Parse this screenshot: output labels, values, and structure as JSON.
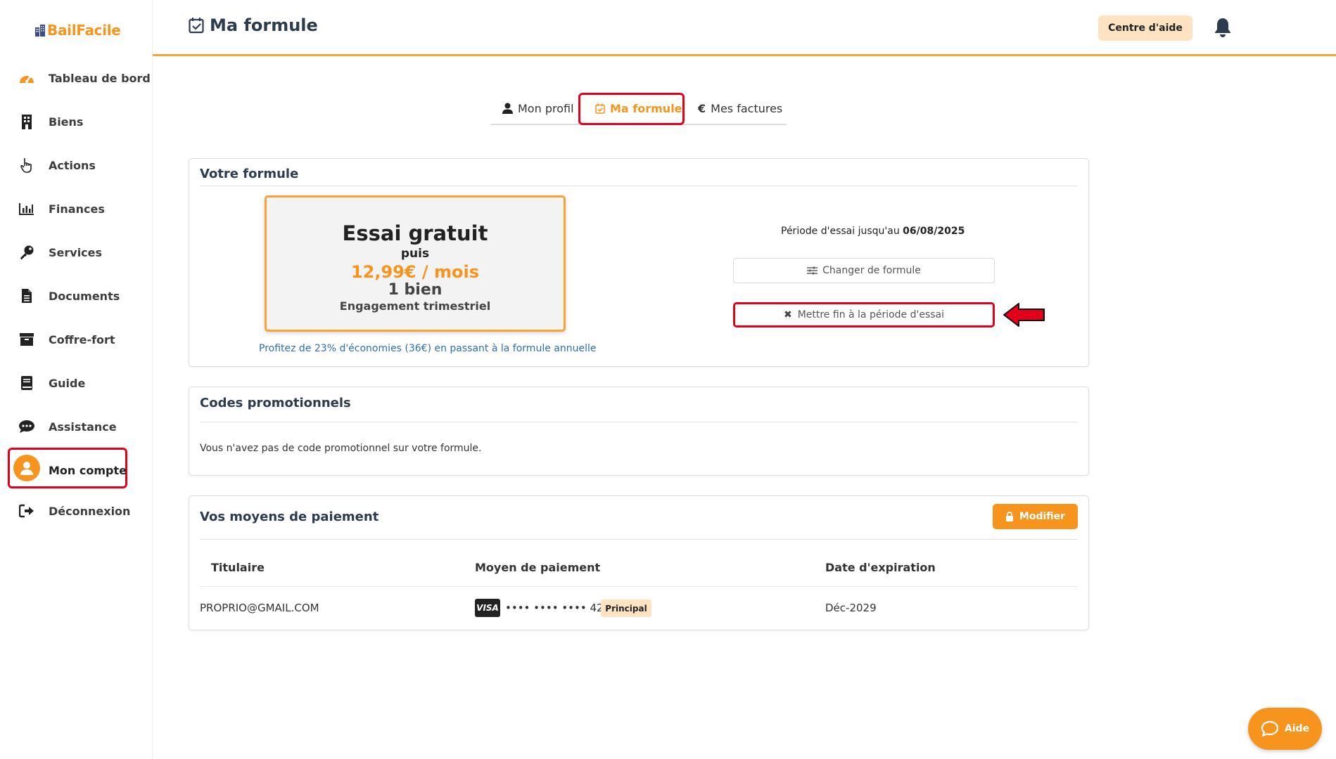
{
  "app": {
    "logo_text": "BailFacile"
  },
  "sidebar": {
    "items": [
      {
        "label": "Tableau de bord",
        "icon": "gauge-icon"
      },
      {
        "label": "Biens",
        "icon": "building-icon"
      },
      {
        "label": "Actions",
        "icon": "hand-pointer-icon"
      },
      {
        "label": "Finances",
        "icon": "bar-chart-icon"
      },
      {
        "label": "Services",
        "icon": "key-icon"
      },
      {
        "label": "Documents",
        "icon": "file-icon"
      },
      {
        "label": "Coffre-fort",
        "icon": "archive-icon"
      },
      {
        "label": "Guide",
        "icon": "book-icon"
      },
      {
        "label": "Assistance",
        "icon": "chat-icon"
      },
      {
        "label": "Mon compte",
        "icon": "user-avatar-icon"
      },
      {
        "label": "Déconnexion",
        "icon": "logout-icon"
      }
    ],
    "active_item": "Mon compte"
  },
  "header": {
    "title": "Ma formule",
    "help_button": "Centre d'aide"
  },
  "tabs": [
    {
      "label": "Mon profil",
      "icon": "user-icon"
    },
    {
      "label": "Ma formule",
      "icon": "calendar-check-icon",
      "active": true
    },
    {
      "label": "Mes factures",
      "icon": "euro-icon"
    }
  ],
  "plan_card": {
    "title": "Votre formule",
    "plan_name": "Essai gratuit",
    "then": "puis",
    "price": "12,99€ / mois",
    "units": "1 bien",
    "commitment": "Engagement trimestriel",
    "promo_link": "Profitez de 23% d'économies (36€) en passant à la formule annuelle",
    "trial_prefix": "Période d'essai jusqu'au",
    "trial_date": "06/08/2025",
    "change_button": "Changer de formule",
    "end_trial_button": "Mettre fin à la période d'essai"
  },
  "promo_card": {
    "title": "Codes promotionnels",
    "empty_text": "Vous n'avez pas de code promotionnel sur votre formule."
  },
  "payment_card": {
    "title": "Vos moyens de paiement",
    "modify_button": "Modifier",
    "columns": [
      "Titulaire",
      "Moyen de paiement",
      "Date d'expiration"
    ],
    "rows": [
      {
        "holder": "PROPRIO@GMAIL.COM",
        "brand": "VISA",
        "card_number": "•••• •••• •••• 4242",
        "badge": "Principal",
        "expiration": "Déc-2029"
      }
    ]
  },
  "help_widget": {
    "label": "Aide"
  },
  "colors": {
    "accent": "#f7941d",
    "highlight": "#e3001b",
    "title": "#2d3b4e",
    "link": "#2f6eb5"
  }
}
